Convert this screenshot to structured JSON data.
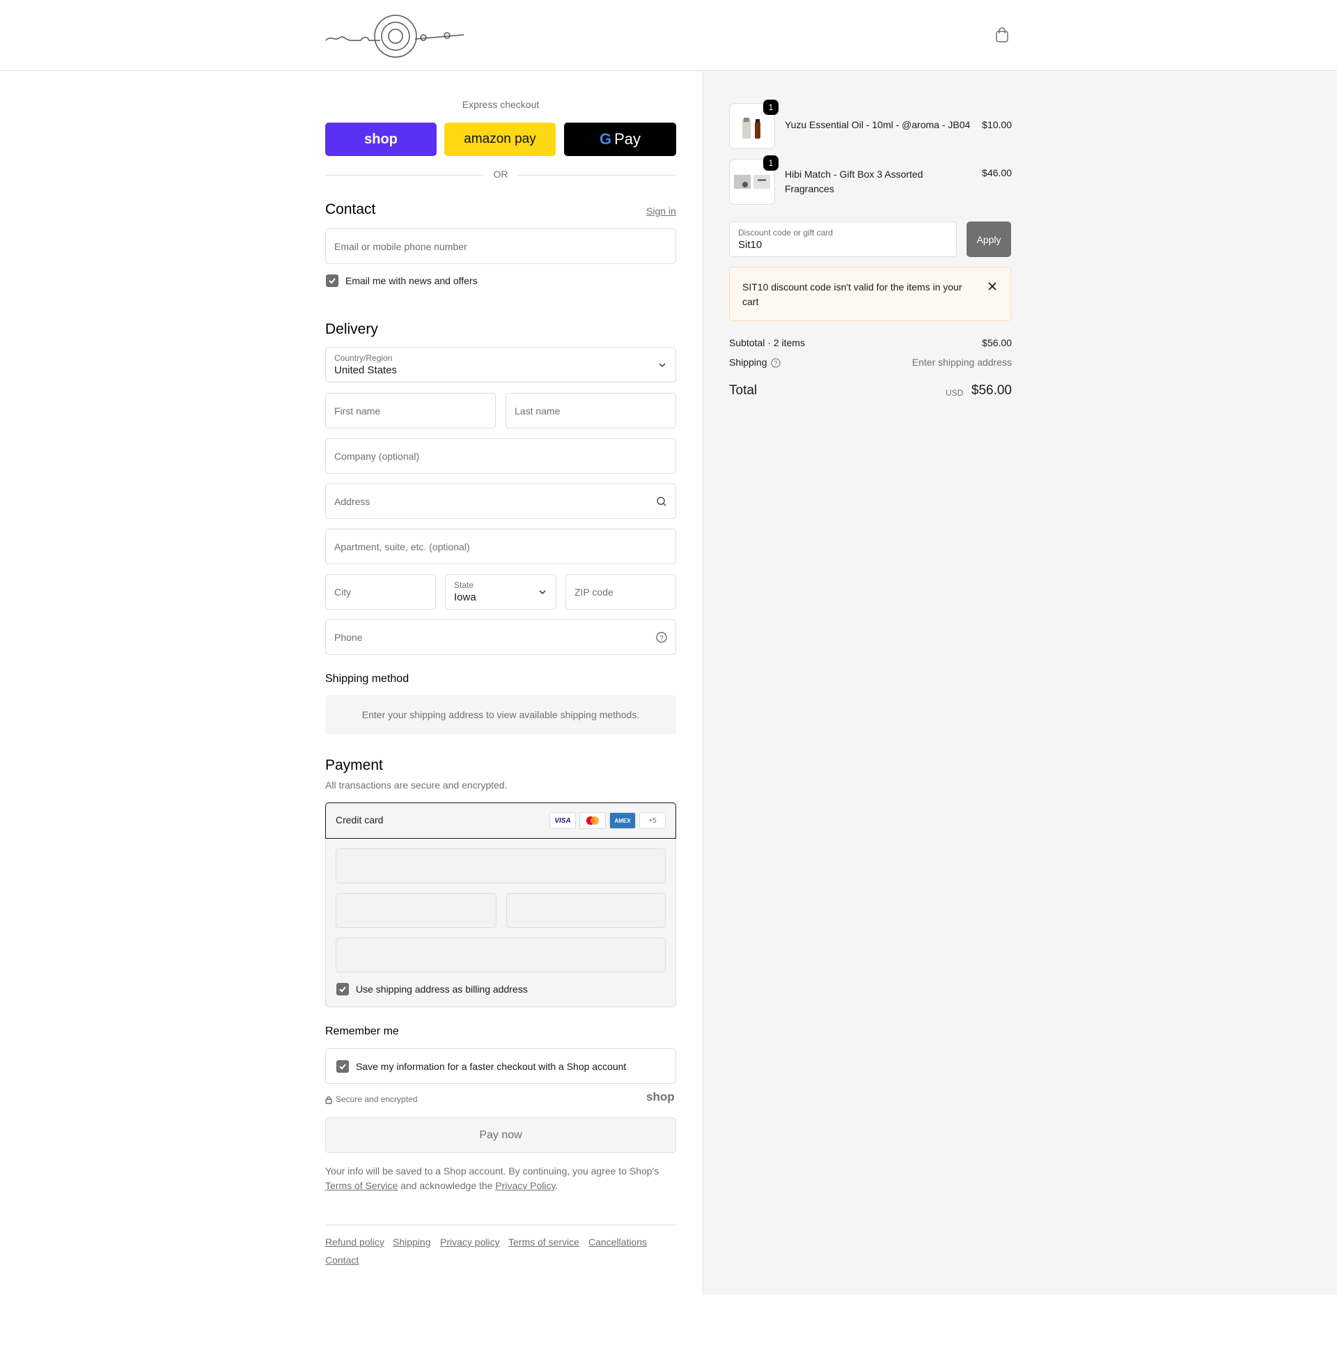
{
  "express": {
    "title": "Express checkout",
    "or": "OR",
    "shop_label": "shop",
    "amazon_label": "amazon pay",
    "gpay_label": "Pay"
  },
  "contact": {
    "title": "Contact",
    "sign_in": "Sign in",
    "email_placeholder": "Email or mobile phone number",
    "news_label": "Email me with news and offers"
  },
  "delivery": {
    "title": "Delivery",
    "country_label": "Country/Region",
    "country_value": "United States",
    "first_name": "First name",
    "last_name": "Last name",
    "company": "Company (optional)",
    "address": "Address",
    "apartment": "Apartment, suite, etc. (optional)",
    "city": "City",
    "state_label": "State",
    "state_value": "Iowa",
    "zip": "ZIP code",
    "phone": "Phone"
  },
  "shipping_method": {
    "title": "Shipping method",
    "message": "Enter your shipping address to view available shipping methods."
  },
  "payment": {
    "title": "Payment",
    "subtitle": "All transactions are secure and encrypted.",
    "method": "Credit card",
    "more_cards": "+5",
    "billing_label": "Use shipping address as billing address"
  },
  "remember": {
    "title": "Remember me",
    "save_label": "Save my information for a faster checkout with a Shop account",
    "secure": "Secure and encrypted",
    "shop_logo": "shop"
  },
  "pay_now": "Pay now",
  "legal": {
    "part1": "Your info will be saved to a Shop account. By continuing, you agree to Shop's",
    "tos": "Terms of Service",
    "part2": "and acknowledge the",
    "privacy": "Privacy Policy",
    "end": "."
  },
  "footer_links": [
    "Refund policy",
    "Shipping",
    "Privacy policy",
    "Terms of service",
    "Cancellations",
    "Contact"
  ],
  "cart": {
    "items": [
      {
        "qty": "1",
        "name": "Yuzu Essential Oil - 10ml - @aroma - JB04",
        "price": "$10.00"
      },
      {
        "qty": "1",
        "name_line1": "Hibi Match - Gift Box 3 Assorted",
        "name_line2": "Fragrances",
        "price": "$46.00"
      }
    ],
    "discount_label": "Discount code or gift card",
    "discount_value": "Sit10",
    "apply": "Apply",
    "error_line1": "SIT10 discount code isn't valid for the items in your",
    "error_line2": "cart",
    "subtotal_label": "Subtotal · 2 items",
    "subtotal_value": "$56.00",
    "shipping_label": "Shipping",
    "shipping_value": "Enter shipping address",
    "total_label": "Total",
    "currency": "USD",
    "total_value": "$56.00"
  },
  "colors": {
    "shop_purple": "#5a31f4",
    "amazon_yellow": "#ffd814",
    "gpay_black": "#000000",
    "error_bg": "#fff8f0"
  }
}
